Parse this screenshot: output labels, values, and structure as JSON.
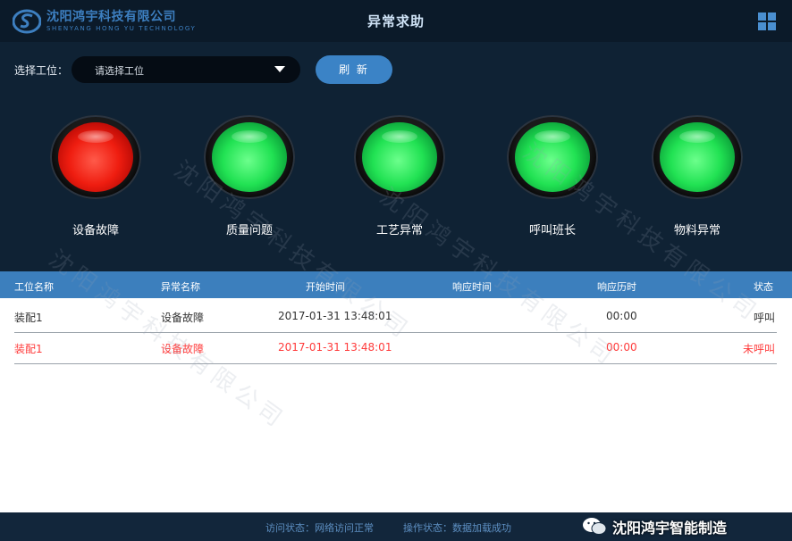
{
  "header": {
    "company_cn": "沈阳鸿宇科技有限公司",
    "company_en": "SHENYANG HONG YU TECHNOLOGY",
    "title": "异常求助",
    "menu_icon": "grid-menu-icon"
  },
  "toolbar": {
    "station_label": "选择工位：",
    "station_placeholder": "请选择工位",
    "refresh_label": "刷 新"
  },
  "alarms": [
    {
      "label": "设备故障",
      "status": "red"
    },
    {
      "label": "质量问题",
      "status": "green"
    },
    {
      "label": "工艺异常",
      "status": "green"
    },
    {
      "label": "呼叫班长",
      "status": "green"
    },
    {
      "label": "物料异常",
      "status": "green"
    }
  ],
  "table": {
    "headers": [
      "工位名称",
      "异常名称",
      "开始时间",
      "响应时间",
      "响应历时",
      "状态"
    ],
    "rows": [
      [
        "装配1",
        "设备故障",
        "2017-01-31 13:48:01",
        "",
        "00:00",
        "呼叫"
      ],
      [
        "装配1",
        "设备故障",
        "2017-01-31 13:48:01",
        "",
        "00:00",
        "未呼叫"
      ]
    ]
  },
  "footer": {
    "access_status": "访问状态：网络访问正常",
    "op_status": "操作状态：数据加载成功",
    "wechat_label": "沈阳鸿宇智能制造"
  },
  "colors": {
    "header_bg": "#0b1a29",
    "panel_bg": "#0f2234",
    "accent_blue": "#3b83c6",
    "alarm_red": "#ef1d10",
    "alarm_green": "#21e253",
    "row_alert": "#ff3b3b"
  }
}
